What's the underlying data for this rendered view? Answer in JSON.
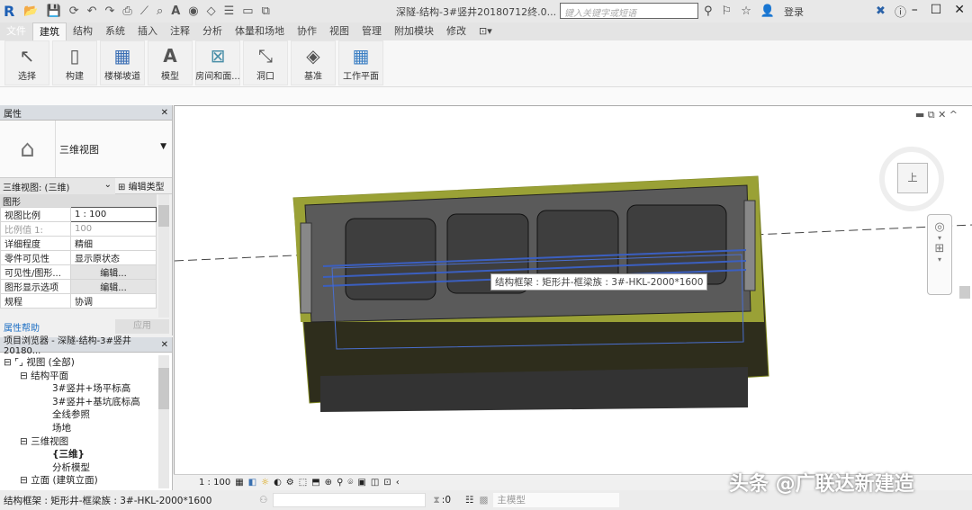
{
  "app": {
    "logo": "R",
    "doc_title": "深隧-结构-3#竖井20180712终.0...",
    "search_placeholder": "键入关键字或短语",
    "login": "登录"
  },
  "tabs": [
    "文件",
    "建筑",
    "结构",
    "系统",
    "插入",
    "注释",
    "分析",
    "体量和场地",
    "协作",
    "视图",
    "管理",
    "附加模块",
    "修改"
  ],
  "ribbon": [
    {
      "label": "选择",
      "icon": "cursor-icon"
    },
    {
      "label": "构建",
      "icon": "wall-icon"
    },
    {
      "label": "楼梯坡道",
      "icon": "stair-icon"
    },
    {
      "label": "模型",
      "icon": "model-text-icon"
    },
    {
      "label": "房间和面...",
      "icon": "room-icon"
    },
    {
      "label": "洞口",
      "icon": "opening-icon"
    },
    {
      "label": "基准",
      "icon": "datum-icon"
    },
    {
      "label": "工作平面",
      "icon": "workplane-icon"
    }
  ],
  "properties": {
    "title": "属性",
    "type_name": "三维视图",
    "instance": "三维视图: (三维)",
    "edit_type": "编辑类型",
    "group": "图形",
    "rows": [
      {
        "k": "视图比例",
        "v": "1 : 100"
      },
      {
        "k": "比例值 1:",
        "v": "100"
      },
      {
        "k": "详细程度",
        "v": "精细"
      },
      {
        "k": "零件可见性",
        "v": "显示原状态"
      },
      {
        "k": "可见性/图形...",
        "v": "编辑..."
      },
      {
        "k": "图形显示选项",
        "v": "编辑..."
      },
      {
        "k": "规程",
        "v": "协调"
      }
    ],
    "help": "属性帮助",
    "apply": "应用"
  },
  "browser": {
    "title": "项目浏览器 - 深隧-结构-3#竖井20180...",
    "items": [
      "视图 (全部)",
      "结构平面",
      "3#竖井+场平标高",
      "3#竖井+基坑底标高",
      "全线参照",
      "场地",
      "三维视图",
      "{三维}",
      "分析模型",
      "立面 (建筑立面)"
    ]
  },
  "viewport": {
    "tooltip": "结构框架 : 矩形井-框梁族 : 3#-HKL-2000*1600",
    "viewcube_face": "上",
    "scale": "1 : 100"
  },
  "status": {
    "text": "结构框架 : 矩形井-框梁族 : 3#-HKL-2000*1600",
    "count": ":0",
    "model": "主模型"
  },
  "watermark": "头条 @广联达新建造",
  "colors": {
    "accent": "#1d5fb4",
    "model_green": "#b9c53a",
    "model_dark": "#2b2b2b"
  }
}
